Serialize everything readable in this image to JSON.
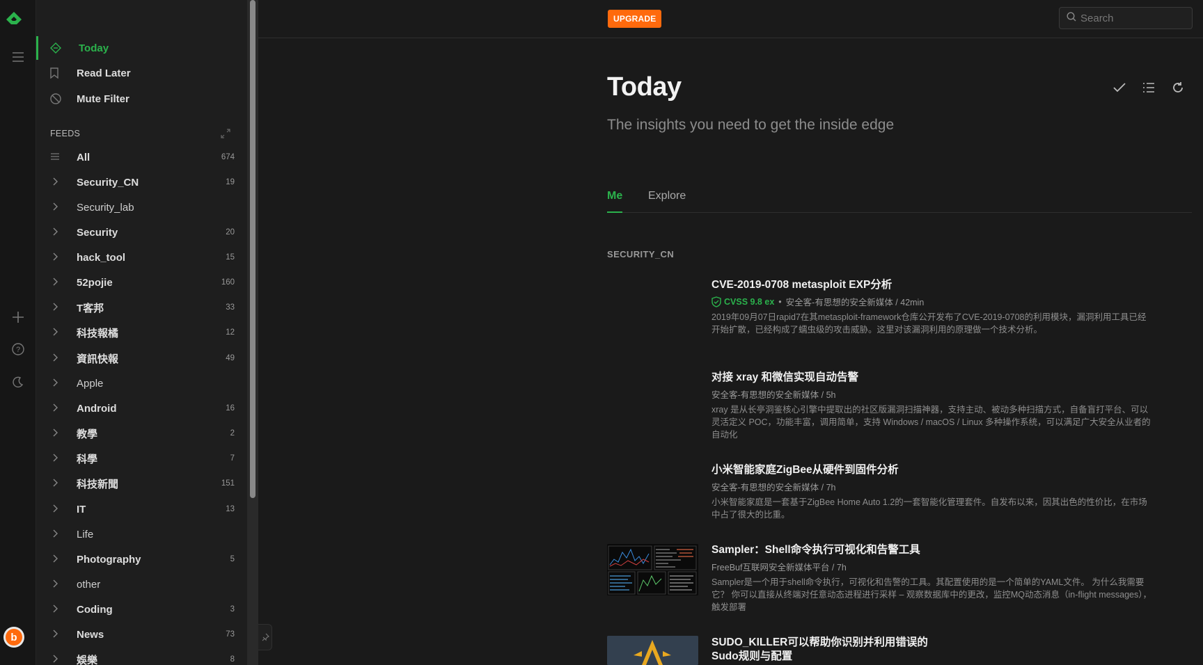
{
  "rail": {
    "icons": [
      "feedly-logo-icon",
      "menu-icon",
      "add-icon",
      "help-icon",
      "moon-icon",
      "avatar"
    ]
  },
  "sidebar": {
    "nav": [
      {
        "label": "Today",
        "icon": "today-icon",
        "active": true
      },
      {
        "label": "Read Later",
        "icon": "bookmark-icon"
      },
      {
        "label": "Mute Filter",
        "icon": "mute-icon"
      }
    ],
    "feeds_header": "FEEDS",
    "feeds": [
      {
        "name": "All",
        "count": "674"
      },
      {
        "name": "Security_CN",
        "count": "19"
      },
      {
        "name": "Security_lab",
        "count": ""
      },
      {
        "name": "Security",
        "count": "20"
      },
      {
        "name": "hack_tool",
        "count": "15"
      },
      {
        "name": "52pojie",
        "count": "160"
      },
      {
        "name": "T客邦",
        "count": "33"
      },
      {
        "name": "科技報橘",
        "count": "12"
      },
      {
        "name": "資訊快報",
        "count": "49"
      },
      {
        "name": "Apple",
        "count": ""
      },
      {
        "name": "Android",
        "count": "16"
      },
      {
        "name": "教學",
        "count": "2"
      },
      {
        "name": "科學",
        "count": "7"
      },
      {
        "name": "科技新聞",
        "count": "151"
      },
      {
        "name": "IT",
        "count": "13"
      },
      {
        "name": "Life",
        "count": ""
      },
      {
        "name": "Photography",
        "count": "5"
      },
      {
        "name": "other",
        "count": ""
      },
      {
        "name": "Coding",
        "count": "3"
      },
      {
        "name": "News",
        "count": "73"
      },
      {
        "name": "娛樂",
        "count": "8"
      }
    ]
  },
  "topbar": {
    "upgrade_label": "UPGRADE",
    "search_placeholder": "Search"
  },
  "main": {
    "title": "Today",
    "subtitle": "The insights you need to get the inside edge",
    "tabs": [
      "Me",
      "Explore"
    ],
    "section": "SECURITY_CN",
    "articles": [
      {
        "title": "CVE-2019-0708 metasploit EXP分析",
        "cvss": "CVSS 9.8 ex",
        "meta": "安全客-有思想的安全新媒体 / 42min",
        "summary": "2019年09月07日rapid7在其metasploit-framework仓库公开发布了CVE-2019-0708的利用模块，漏洞利用工具已经开始扩散，已经构成了蠕虫级的攻击威胁。这里对该漏洞利用的原理做一个技术分析。"
      },
      {
        "title": "对接 xray 和微信实现自动告警",
        "meta": "安全客-有思想的安全新媒体 / 5h",
        "summary": "xray 是从长亭洞鉴核心引擎中提取出的社区版漏洞扫描神器，支持主动、被动多种扫描方式，自备盲打平台、可以灵活定义 POC，功能丰富，调用简单，支持 Windows / macOS / Linux 多种操作系统，可以满足广大安全从业者的自动化"
      },
      {
        "title": "小米智能家庭ZigBee从硬件到固件分析",
        "meta": "安全客-有思想的安全新媒体 / 7h",
        "summary": "小米智能家庭是一套基于ZigBee Home Auto 1.2的一套智能化管理套件。自发布以来，因其出色的性价比，在市场中占了很大的比重。"
      },
      {
        "title": "Sampler：Shell命令执行可视化和告警工具",
        "meta": "FreeBuf互联网安全新媒体平台 / 7h",
        "summary": "Sampler是一个用于shell命令执行，可视化和告警的工具。其配置使用的是一个简单的YAML文件。 为什么我需要它？ 你可以直接从终端对任意动态进程进行采样 – 观察数据库中的更改，监控MQ动态消息（in-flight messages），触发部署"
      },
      {
        "title": "SUDO_KILLER可以帮助你识别并利用错误的Sudo规则与配置",
        "meta": "",
        "summary": ""
      }
    ]
  },
  "colors": {
    "accent": "#2bb24c",
    "upgrade": "#ff6a0d",
    "background": "#1a1a1a"
  }
}
